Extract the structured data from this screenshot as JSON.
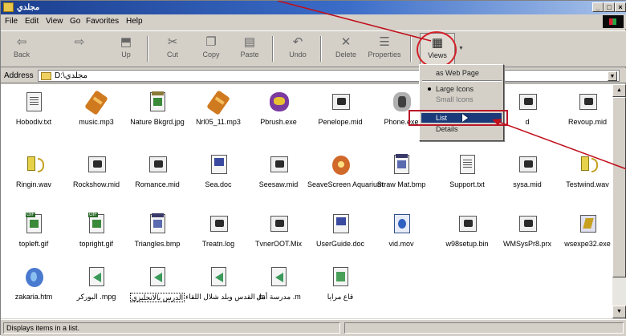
{
  "window": {
    "title": "مجلدي"
  },
  "menu": [
    "File",
    "Edit",
    "View",
    "Go",
    "Favorites",
    "Help"
  ],
  "toolbar": [
    {
      "id": "back",
      "label": "Back",
      "icon": "back-arrow-icon"
    },
    {
      "id": "forward",
      "label": "",
      "icon": "forward-arrow-icon"
    },
    {
      "id": "up",
      "label": "Up",
      "icon": "up-folder-icon"
    },
    {
      "id": "cut",
      "label": "Cut",
      "icon": "scissors-icon"
    },
    {
      "id": "copy",
      "label": "Copy",
      "icon": "copy-icon"
    },
    {
      "id": "paste",
      "label": "Paste",
      "icon": "paste-icon"
    },
    {
      "id": "undo",
      "label": "Undo",
      "icon": "undo-icon"
    },
    {
      "id": "delete",
      "label": "Delete",
      "icon": "delete-x-icon"
    },
    {
      "id": "properties",
      "label": "Properties",
      "icon": "properties-icon"
    },
    {
      "id": "views",
      "label": "Views",
      "icon": "views-icon"
    }
  ],
  "address": {
    "label": "Address",
    "value": "D:\\مجلدي"
  },
  "views_menu": {
    "items": [
      "as Web Page",
      "Large Icons",
      "Small Icons",
      "List",
      "Details"
    ],
    "selected": "Large Icons",
    "highlighted": "List"
  },
  "files": [
    {
      "name": "Hobodiv.txt",
      "type": "doc"
    },
    {
      "name": "music.mp3",
      "type": "mp3"
    },
    {
      "name": "Nature Bkgrd.jpg",
      "type": "jpg"
    },
    {
      "name": "Nrl05_11.mp3",
      "type": "mp3"
    },
    {
      "name": "Pbrush.exe",
      "type": "exe1"
    },
    {
      "name": "Penelope.mid",
      "type": "mid"
    },
    {
      "name": "Phone.exe",
      "type": "exe2"
    },
    {
      "name": "",
      "type": "none"
    },
    {
      "name": "d",
      "type": "mid"
    },
    {
      "name": "Revoup.mid",
      "type": "mid"
    },
    {
      "name": "Ringin.wav",
      "type": "wav"
    },
    {
      "name": "Rockshow.mid",
      "type": "mid"
    },
    {
      "name": "Romance.mid",
      "type": "mid"
    },
    {
      "name": "Sea.doc",
      "type": "docw"
    },
    {
      "name": "Seesaw.mid",
      "type": "mid"
    },
    {
      "name": "SeaveScreen Aquarium",
      "type": "scr"
    },
    {
      "name": "Straw Mat.bmp",
      "type": "bmp"
    },
    {
      "name": "Support.txt",
      "type": "doc"
    },
    {
      "name": "sysa.mid",
      "type": "mid"
    },
    {
      "name": "Testwind.wav",
      "type": "wav"
    },
    {
      "name": "topleft.gif",
      "type": "gif"
    },
    {
      "name": "topright.gif",
      "type": "gif"
    },
    {
      "name": "Triangles.bmp",
      "type": "bmp"
    },
    {
      "name": "Treatn.log",
      "type": "mid"
    },
    {
      "name": "TvnerOOT.Mix",
      "type": "mid"
    },
    {
      "name": "UserGuide.doc",
      "type": "docw"
    },
    {
      "name": "vid.mov",
      "type": "mov"
    },
    {
      "name": "w98setup.bin",
      "type": "mid"
    },
    {
      "name": "WMSysPr8.prx",
      "type": "mid"
    },
    {
      "name": "wsexpe32.exe",
      "type": "cdr"
    },
    {
      "name": "zakaria.htm",
      "type": "htm"
    },
    {
      "name": "البوركر .mpg",
      "type": "green"
    },
    {
      "name": "الدرس بالانجليزي",
      "type": "green",
      "selected": true
    },
    {
      "name": "القدس وبلد شلال اللقاء .m",
      "type": "green"
    },
    {
      "name": "مدرسة أمل .m",
      "type": "green"
    },
    {
      "name": "قاع مرايا",
      "type": "greenimg"
    }
  ],
  "status": {
    "text": "Displays items in a list."
  }
}
